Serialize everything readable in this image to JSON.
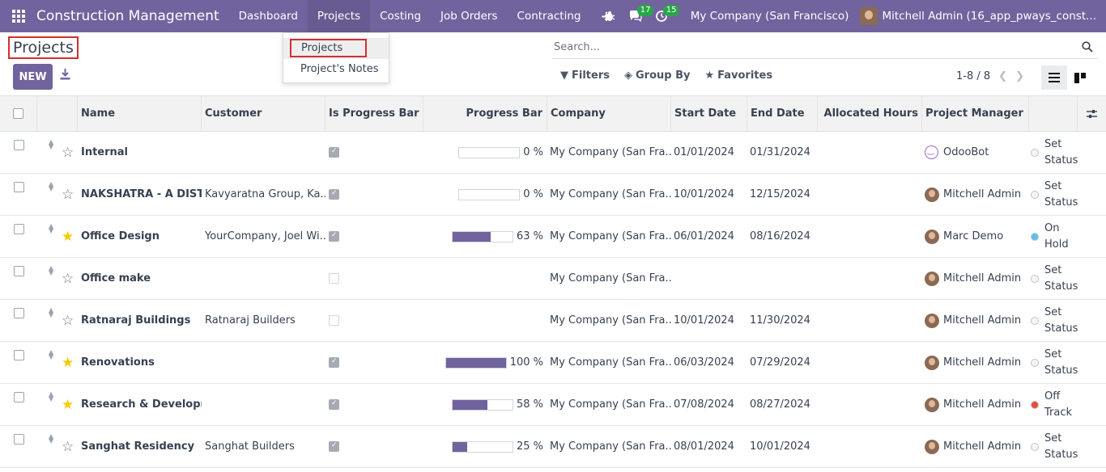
{
  "navbar": {
    "app_name": "Construction Management",
    "menu": [
      "Dashboard",
      "Projects",
      "Costing",
      "Job Orders",
      "Contracting"
    ],
    "add_label": "+",
    "messages_count": "17",
    "activities_count": "15",
    "company": "My Company (San Francisco)",
    "user": "Mitchell Admin (16_app_pways_const..."
  },
  "dropdown": {
    "items": [
      "Projects",
      "Project's Notes"
    ]
  },
  "control_panel": {
    "title": "Projects",
    "new_label": "NEW",
    "search_placeholder": "Search...",
    "filters_label": "Filters",
    "group_by_label": "Group By",
    "favorites_label": "Favorites",
    "pager": "1-8 / 8"
  },
  "table": {
    "headers": {
      "name": "Name",
      "customer": "Customer",
      "is_progress": "Is Progress Bar",
      "progress": "Progress Bar",
      "company": "Company",
      "start": "Start Date",
      "end": "End Date",
      "hours": "Allocated Hours",
      "manager": "Project Manager"
    },
    "rows": [
      {
        "favorite": false,
        "name": "Internal",
        "customer": "",
        "is_progress": true,
        "progress": 0,
        "progress_text": "0 %",
        "company": "My Company (San Fra...",
        "start": "01/01/2024",
        "end": "01/31/2024",
        "manager": "OdooBot",
        "manager_avatar": "bot",
        "status_line1": "Set",
        "status_line2": "Status",
        "status_color": "#f3f4f6"
      },
      {
        "favorite": false,
        "name": "NAKSHATRA - A DISTI...",
        "customer": "Kavyaratna Group, Ka...",
        "is_progress": true,
        "progress": 0,
        "progress_text": "0 %",
        "company": "My Company (San Fra...",
        "start": "10/01/2024",
        "end": "12/15/2024",
        "manager": "Mitchell Admin",
        "manager_avatar": "user",
        "status_line1": "Set",
        "status_line2": "Status",
        "status_color": "#f3f4f6"
      },
      {
        "favorite": true,
        "name": "Office Design",
        "customer": "YourCompany, Joel Wi...",
        "is_progress": true,
        "progress": 63,
        "progress_text": "63 %",
        "company": "My Company (San Fra...",
        "start": "06/01/2024",
        "end": "08/16/2024",
        "manager": "Marc Demo",
        "manager_avatar": "user",
        "status_line1": "On",
        "status_line2": "Hold",
        "status_color": "#5bc0eb"
      },
      {
        "favorite": false,
        "name": "Office make",
        "customer": "",
        "is_progress": false,
        "progress": null,
        "progress_text": "",
        "company": "My Company (San Fra...",
        "start": "",
        "end": "",
        "manager": "Mitchell Admin",
        "manager_avatar": "user",
        "status_line1": "Set",
        "status_line2": "Status",
        "status_color": "#f3f4f6"
      },
      {
        "favorite": false,
        "name": "Ratnaraj Buildings",
        "customer": "Ratnaraj Builders",
        "is_progress": false,
        "progress": null,
        "progress_text": "",
        "company": "My Company (San Fra...",
        "start": "10/01/2024",
        "end": "11/30/2024",
        "manager": "Mitchell Admin",
        "manager_avatar": "user",
        "status_line1": "Set",
        "status_line2": "Status",
        "status_color": "#f3f4f6"
      },
      {
        "favorite": true,
        "name": "Renovations",
        "customer": "",
        "is_progress": true,
        "progress": 100,
        "progress_text": "100 %",
        "company": "My Company (San Fra...",
        "start": "06/03/2024",
        "end": "07/29/2024",
        "manager": "Mitchell Admin",
        "manager_avatar": "user",
        "status_line1": "Set",
        "status_line2": "Status",
        "status_color": "#f3f4f6"
      },
      {
        "favorite": true,
        "name": "Research & Developm...",
        "customer": "",
        "is_progress": true,
        "progress": 58,
        "progress_text": "58 %",
        "company": "My Company (San Fra...",
        "start": "07/08/2024",
        "end": "08/27/2024",
        "manager": "Mitchell Admin",
        "manager_avatar": "user",
        "status_line1": "Off",
        "status_line2": "Track",
        "status_color": "#e74c3c"
      },
      {
        "favorite": false,
        "name": "Sanghat Residency",
        "customer": "Sanghat Builders",
        "is_progress": true,
        "progress": 25,
        "progress_text": "25 %",
        "company": "My Company (San Fra...",
        "start": "08/01/2024",
        "end": "10/01/2024",
        "manager": "Mitchell Admin",
        "manager_avatar": "user",
        "status_line1": "Set",
        "status_line2": "Status",
        "status_color": "#f3f4f6"
      }
    ]
  }
}
